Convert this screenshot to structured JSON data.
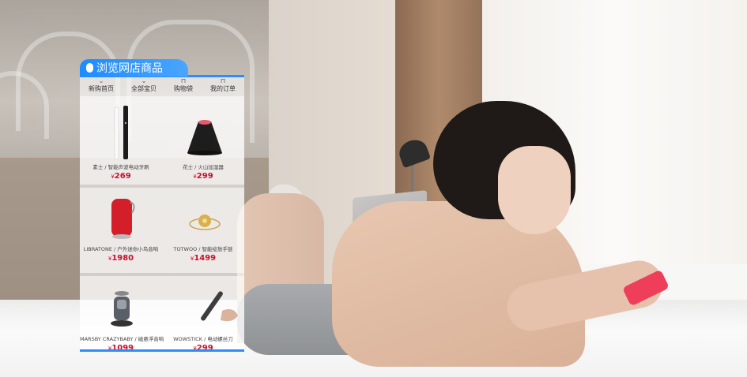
{
  "panel": {
    "title": "浏览网店商品",
    "accent_color": "#2c8dff",
    "price_color": "#c8102e"
  },
  "nav": {
    "items": [
      {
        "label": "新购首页",
        "icon": "home-icon",
        "active": true
      },
      {
        "label": "全部宝贝",
        "icon": "chevron-down-icon",
        "active": false
      },
      {
        "label": "购物袋",
        "icon": "bag-icon",
        "active": false
      },
      {
        "label": "我的订单",
        "icon": "user-icon",
        "active": false
      }
    ]
  },
  "products": [
    {
      "name": "素士 / 智能声波电动牙刷",
      "price": "269",
      "currency": "¥",
      "icon": "toothbrush-icon"
    },
    {
      "name": "花士 / 火山加湿器",
      "price": "299",
      "currency": "¥",
      "icon": "humidifier-icon"
    },
    {
      "name": "LIBRATONE / 户外迷你小鸟音响",
      "price": "1980",
      "currency": "¥",
      "icon": "speaker-icon"
    },
    {
      "name": "TOTWOO / 智能绽放手链",
      "price": "1499",
      "currency": "¥",
      "icon": "bracelet-icon"
    },
    {
      "name": "MARSBY CRAZYBABY / 磁悬浮音响",
      "price": "1099",
      "currency": "¥",
      "icon": "levitating-speaker-icon"
    },
    {
      "name": "WOWSTICK / 电动螺丝刀",
      "price": "299",
      "currency": "¥",
      "icon": "screwdriver-icon"
    }
  ]
}
